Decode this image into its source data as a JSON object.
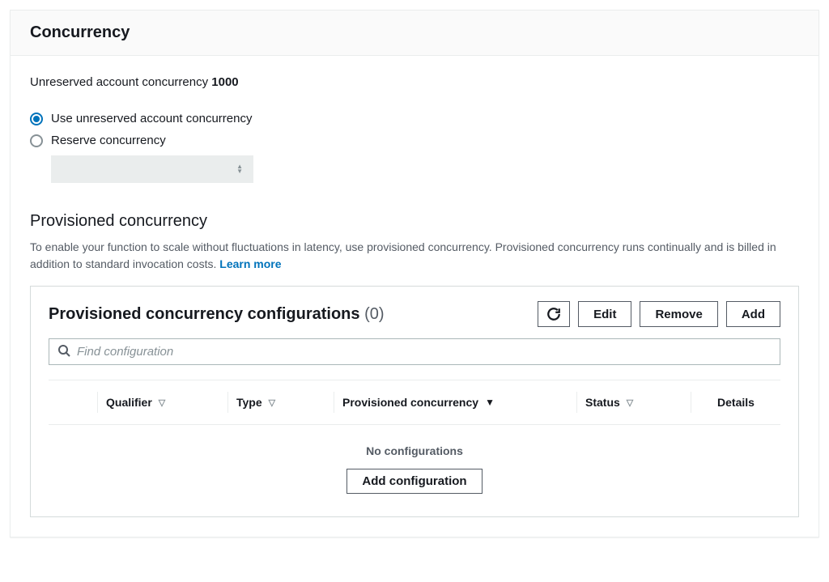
{
  "header": {
    "title": "Concurrency"
  },
  "account_concurrency": {
    "label": "Unreserved account concurrency",
    "value": "1000"
  },
  "radios": {
    "use_unreserved": "Use unreserved account concurrency",
    "reserve": "Reserve concurrency"
  },
  "provisioned": {
    "title": "Provisioned concurrency",
    "description": "To enable your function to scale without fluctuations in latency, use provisioned concurrency. Provisioned concurrency runs continually and is billed in addition to standard invocation costs. ",
    "learn_more": "Learn more"
  },
  "config_panel": {
    "title": "Provisioned concurrency configurations",
    "count": "(0)",
    "buttons": {
      "edit": "Edit",
      "remove": "Remove",
      "add": "Add"
    },
    "search_placeholder": "Find configuration",
    "columns": {
      "qualifier": "Qualifier",
      "type": "Type",
      "provisioned": "Provisioned concurrency",
      "status": "Status",
      "details": "Details"
    },
    "empty_text": "No configurations",
    "add_config": "Add configuration"
  }
}
